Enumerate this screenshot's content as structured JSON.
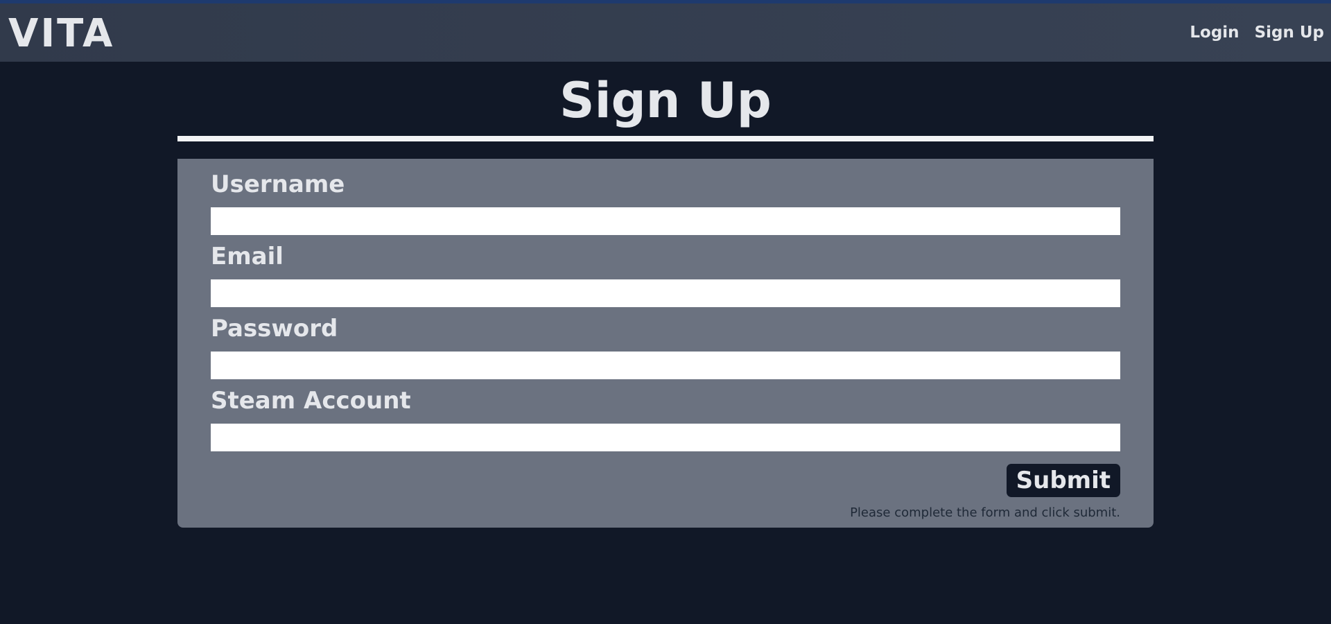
{
  "header": {
    "logo": "VITA",
    "nav": {
      "login": "Login",
      "signup": "Sign Up"
    }
  },
  "page": {
    "title": "Sign Up"
  },
  "form": {
    "fields": [
      {
        "label": "Username",
        "value": ""
      },
      {
        "label": "Email",
        "value": ""
      },
      {
        "label": "Password",
        "value": ""
      },
      {
        "label": "Steam Account",
        "value": ""
      }
    ],
    "submit_label": "Submit",
    "status_message": "Please complete the form and click submit."
  },
  "colors": {
    "background": "#111827",
    "header": "#374151",
    "card": "#6b7280",
    "text": "#e5e7eb"
  }
}
